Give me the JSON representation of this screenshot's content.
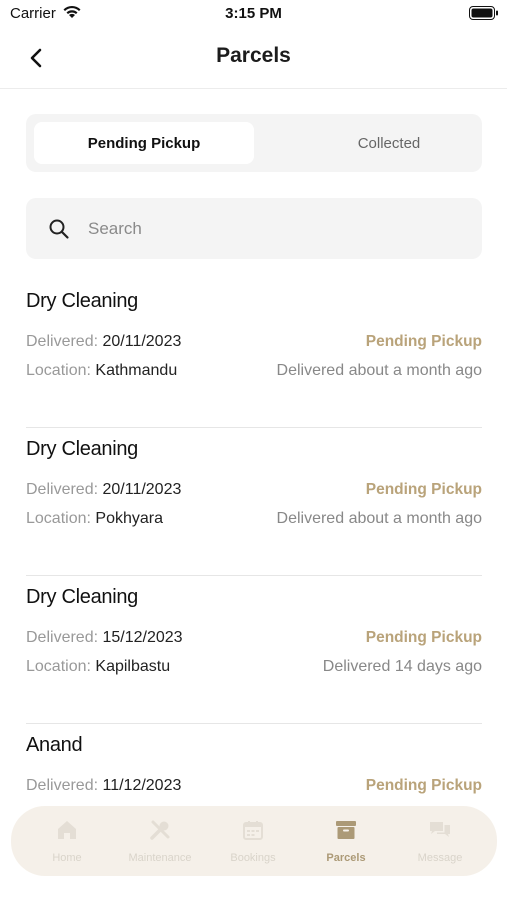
{
  "status_bar": {
    "carrier": "Carrier",
    "time": "3:15 PM"
  },
  "nav": {
    "title": "Parcels"
  },
  "segments": {
    "active": "Pending Pickup",
    "inactive": "Collected"
  },
  "search": {
    "placeholder": "Search"
  },
  "parcels": [
    {
      "name": "Dry Cleaning",
      "delivered_label": "Delivered:",
      "delivered": "20/11/2023",
      "location_label": "Location:",
      "location": "Kathmandu",
      "status": "Pending Pickup",
      "ago_label": "Delivered",
      "ago": "about a month ago"
    },
    {
      "name": "Dry Cleaning",
      "delivered_label": "Delivered:",
      "delivered": "20/11/2023",
      "location_label": "Location:",
      "location": "Pokhyara",
      "status": "Pending Pickup",
      "ago_label": "Delivered",
      "ago": "about a month ago"
    },
    {
      "name": "Dry Cleaning",
      "delivered_label": "Delivered:",
      "delivered": "15/12/2023",
      "location_label": "Location:",
      "location": "Kapilbastu",
      "status": "Pending Pickup",
      "ago_label": "Delivered",
      "ago": "14 days ago"
    },
    {
      "name": "Anand",
      "delivered_label": "Delivered:",
      "delivered": "11/12/2023",
      "status": "Pending Pickup"
    }
  ],
  "tabbar": {
    "items": [
      {
        "label": "Home",
        "icon": "home-icon"
      },
      {
        "label": "Maintenance",
        "icon": "tools-icon"
      },
      {
        "label": "Bookings",
        "icon": "calendar-icon"
      },
      {
        "label": "Parcels",
        "icon": "box-icon",
        "active": true
      },
      {
        "label": "Message",
        "icon": "chat-icon"
      }
    ]
  },
  "colors": {
    "accent": "#b9a37a",
    "tab_active": "#a89570",
    "tabbar_bg": "#f5f0e8"
  }
}
